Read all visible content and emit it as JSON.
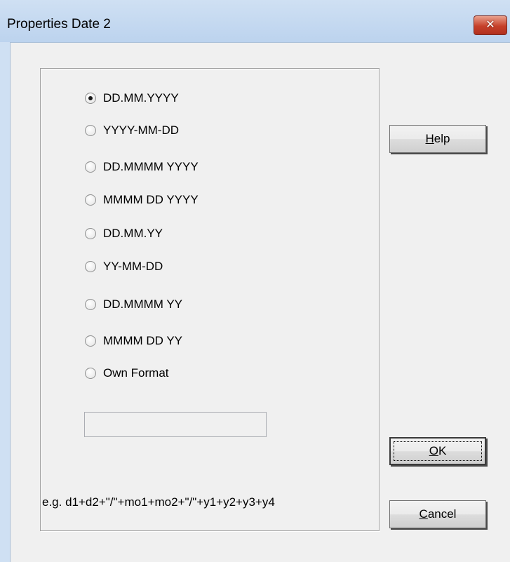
{
  "window": {
    "title": "Properties Date 2",
    "close_glyph": "✕"
  },
  "formats": [
    {
      "label": "DD.MM.YYYY",
      "checked": true
    },
    {
      "label": "YYYY-MM-DD",
      "checked": false
    },
    {
      "label": "DD.MMMM YYYY",
      "checked": false
    },
    {
      "label": "MMMM DD YYYY",
      "checked": false
    },
    {
      "label": "DD.MM.YY",
      "checked": false
    },
    {
      "label": "YY-MM-DD",
      "checked": false
    },
    {
      "label": "DD.MMMM YY",
      "checked": false
    },
    {
      "label": "MMMM DD YY",
      "checked": false
    },
    {
      "label": "Own Format",
      "checked": false
    }
  ],
  "own_format_input": {
    "value": ""
  },
  "hint": "e.g. d1+d2+\"/\"+mo1+mo2+\"/\"+y1+y2+y3+y4",
  "buttons": {
    "help": {
      "mnemonic": "H",
      "rest": "elp"
    },
    "ok": {
      "mnemonic": "O",
      "rest": "K"
    },
    "cancel": {
      "mnemonic": "C",
      "rest": "ancel"
    }
  }
}
